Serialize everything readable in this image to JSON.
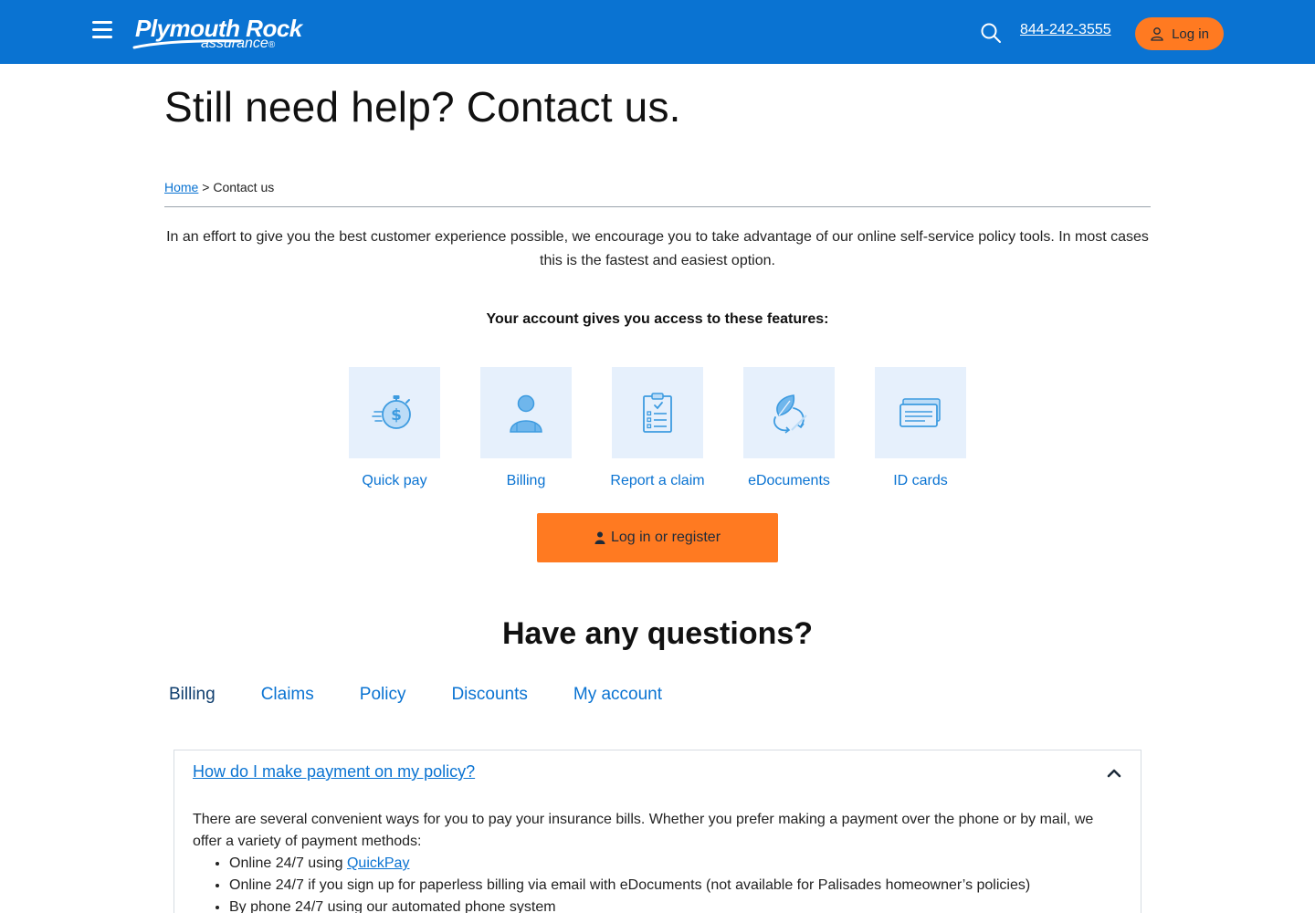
{
  "header": {
    "logo_main": "Plymouth Rock",
    "logo_sub": "assurance",
    "logo_mark": "®",
    "phone": "844-242-3555",
    "login_label": "Log in",
    "icons": {
      "menu": "hamburger-icon",
      "search": "search-icon",
      "user": "user-icon"
    }
  },
  "page": {
    "title": "Still need help? Contact us.",
    "breadcrumb": {
      "home": "Home",
      "separator": ">",
      "current": "Contact us"
    },
    "intro": "In an effort to give you the best customer experience possible, we encourage you to take advantage of our online self-service policy tools. In most cases this is the fastest and easiest  option.",
    "features_heading": "Your account gives you access to these features:"
  },
  "features": [
    {
      "label": "Quick pay",
      "icon": "stopwatch-dollar-icon"
    },
    {
      "label": "Billing",
      "icon": "person-icon"
    },
    {
      "label": "Report a claim",
      "icon": "clipboard-checklist-icon"
    },
    {
      "label": "eDocuments",
      "icon": "leaf-recycle-icon"
    },
    {
      "label": "ID cards",
      "icon": "id-cards-icon"
    }
  ],
  "cta": {
    "label": "Log in or register"
  },
  "questions": {
    "title": "Have any questions?",
    "tabs": [
      "Billing",
      "Claims",
      "Policy",
      "Discounts",
      "My account"
    ],
    "active_tab": "Billing",
    "faq": {
      "question": "How do I make payment on my policy?",
      "answer_intro": "There are several convenient ways for you to pay your insurance bills. Whether you prefer making a payment over the phone or by mail, we offer a variety of payment methods:",
      "items": [
        {
          "prefix": "Online 24/7 using ",
          "link": "QuickPay"
        },
        {
          "text": "Online 24/7 if you sign up for paperless billing via email with eDocuments (not available for Palisades homeowner’s policies)"
        },
        {
          "text": "By phone 24/7 using our automated phone system"
        }
      ]
    }
  },
  "colors": {
    "brand_blue": "#0a73d2",
    "accent_orange": "#ff7a21",
    "tile_bg": "#e6f0fc",
    "icon_blue": "#3d9be0"
  }
}
